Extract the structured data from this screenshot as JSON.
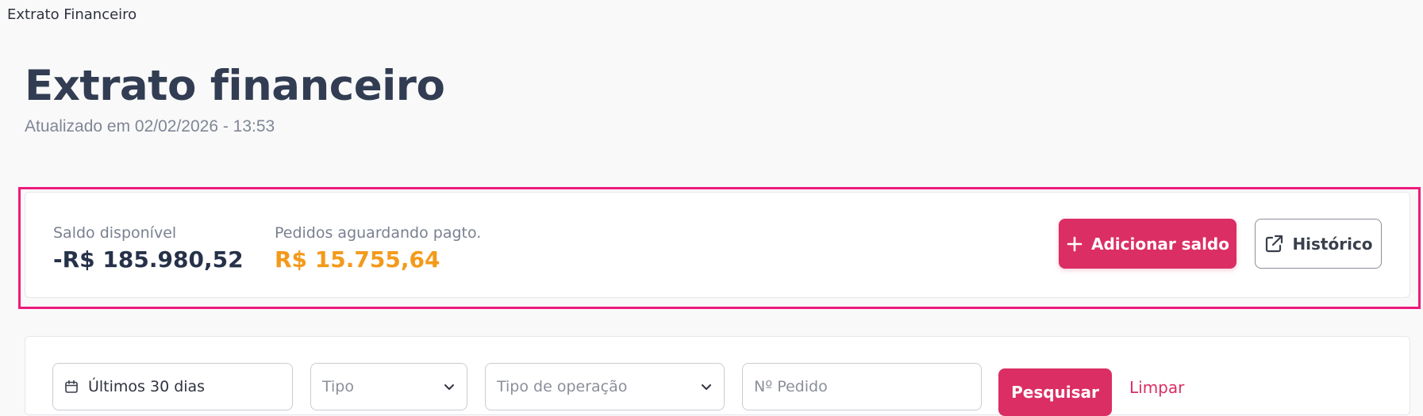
{
  "window": {
    "tab_title": "Extrato Financeiro"
  },
  "header": {
    "title": "Extrato financeiro",
    "updated": "Atualizado em 02/02/2026 - 13:53"
  },
  "balance": {
    "available_label": "Saldo disponível",
    "available_value": "-R$ 185.980,52",
    "pending_label": "Pedidos aguardando pagto.",
    "pending_value": "R$ 15.755,64",
    "add_button": "Adicionar saldo",
    "history_button": "Histórico"
  },
  "filters": {
    "period_value": "Últimos 30 dias",
    "type_placeholder": "Tipo",
    "operation_placeholder": "Tipo de operação",
    "order_placeholder": "Nº Pedido",
    "search_button": "Pesquisar",
    "clear_link": "Limpar"
  },
  "colors": {
    "accent": "#db2e64",
    "highlight_frame": "#ee1b7c",
    "pending_value": "#f39a1b",
    "title": "#323d53"
  },
  "icons": {
    "add": "plus-icon",
    "history": "external-link-icon",
    "period": "calendar-icon",
    "dropdown": "chevron-down-icon"
  }
}
